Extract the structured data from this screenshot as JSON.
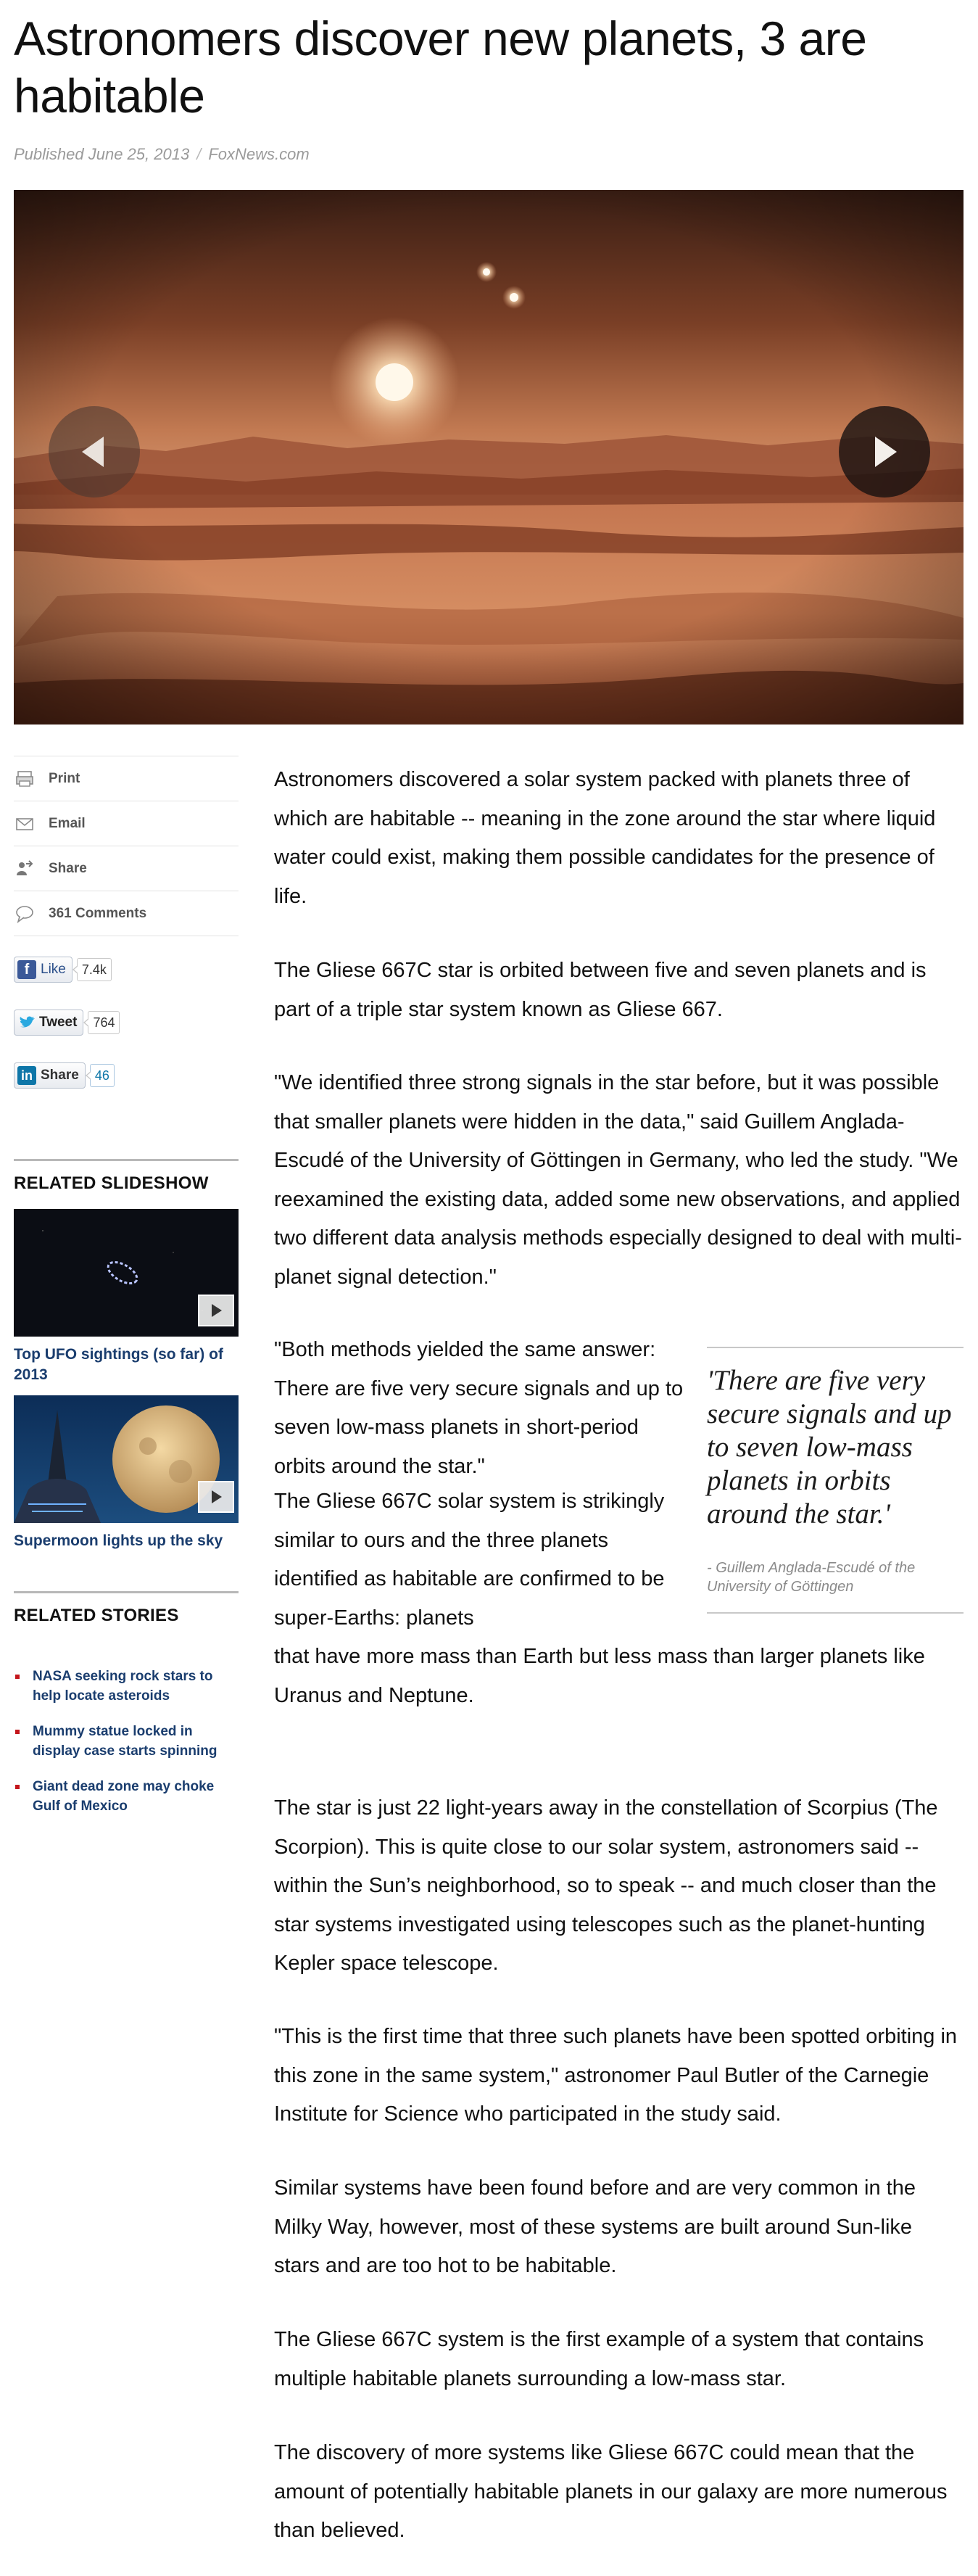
{
  "headline": "Astronomers discover new planets, 3 are habitable",
  "byline": {
    "published": "Published June 25, 2013",
    "separator": "/",
    "source": "FoxNews.com"
  },
  "hero": {
    "alt_description_icon": "slideshow-image",
    "prev_icon": "arrow-left-icon",
    "next_icon": "arrow-right-icon"
  },
  "share_tools": [
    {
      "label": "Print",
      "icon": "print-icon"
    },
    {
      "label": "Email",
      "icon": "email-icon"
    },
    {
      "label": "Share",
      "icon": "share-icon"
    },
    {
      "label": "361 Comments",
      "icon": "comment-icon"
    }
  ],
  "social": {
    "facebook": {
      "label": "Like",
      "count": "7.4k"
    },
    "twitter": {
      "label": "Tweet",
      "count": "764"
    },
    "linkedin": {
      "label": "Share",
      "count": "46"
    }
  },
  "related_slideshow": {
    "title": "RELATED SLIDESHOW",
    "items": [
      {
        "caption": "Top UFO sightings (so far) of 2013"
      },
      {
        "caption": "Supermoon lights up the sky"
      }
    ]
  },
  "related_stories": {
    "title": "RELATED STORIES",
    "items": [
      "NASA seeking rock stars to help locate asteroids",
      "Mummy statue locked in display case starts spinning",
      "Giant dead zone may choke Gulf of Mexico"
    ]
  },
  "article": {
    "p1": "Astronomers discovered a solar system packed with planets three of which are habitable -- meaning in the zone around the star where liquid water could exist, making them possible candidates for the presence of life.",
    "p2": "The Gliese 667C star is orbited between five and seven planets and is part of a triple star system known as Gliese 667.",
    "p3": "\"We identified three strong signals in the star before, but it was possible that smaller planets were hidden in the data,\" said Guillem Anglada-Escudé of the University of Göttingen in Germany, who led the study. \"We reexamined the existing data, added some new observations, and applied two different data analysis methods especially designed to deal with multi-planet signal detection.\"",
    "p4": "\"Both methods yielded the same answer: There are five very secure signals and up to seven low-mass planets in short-period orbits around the star.\"",
    "p5a": "The Gliese 667C solar system is strikingly similar to ours and the three planets identified as habitable are confirmed to be super-Earths: planets",
    "p5b": "that have more mass than Earth but less mass than larger planets like Uranus and Neptune.",
    "p6": "The star is just 22 light-years away in the constellation of Scorpius (The Scorpion). This is quite close to our solar system, astronomers said -- within the Sun’s neighborhood, so to speak -- and much closer than the star systems investigated using telescopes such as the planet-hunting Kepler space telescope.",
    "p7": "\"This is the first time that three such planets have been spotted orbiting in this zone in the same system,\" astronomer Paul Butler of the Carnegie Institute for Science who participated in the study said.",
    "p8": "Similar systems have been found before and are very common in the Milky Way, however, most of these systems are built around Sun-like stars and are too hot to be habitable.",
    "p9": "The Gliese 667C system is the first example of a system that contains multiple habitable planets surrounding a low-mass star.",
    "p10": "The discovery of more systems like Gliese 667C could mean that the amount of potentially habitable planets in our galaxy are more numerous than believed."
  },
  "pullquote": {
    "quote": "'There are five very secure signals and up to seven low-mass planets in orbits around the star.'",
    "attribution": "- Guillem Anglada-Escudé of the University of Göttingen"
  },
  "colors": {
    "link": "#1a3d6e",
    "bullet": "#c4161c",
    "byline": "#9a9a9a"
  }
}
